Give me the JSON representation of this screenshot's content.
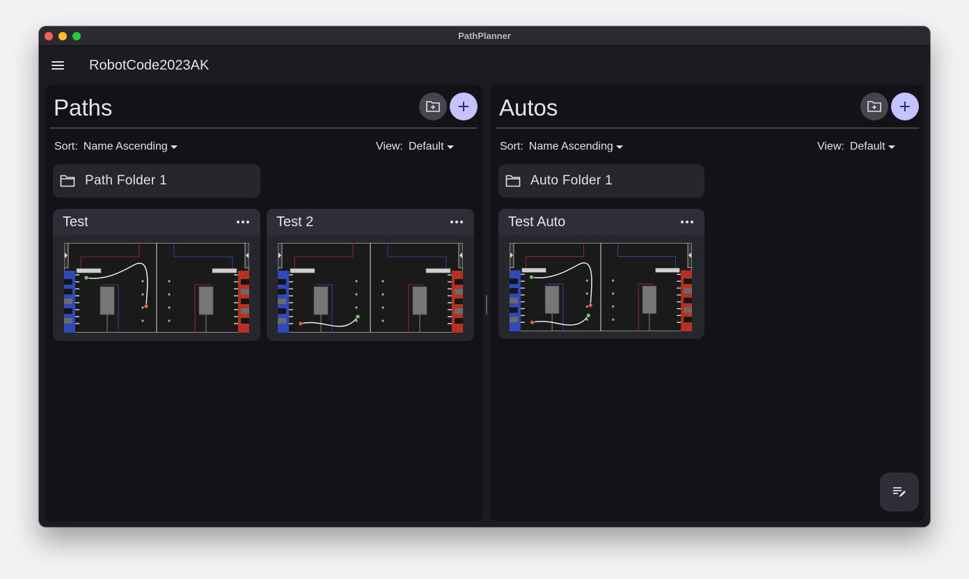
{
  "window": {
    "title": "PathPlanner"
  },
  "appbar": {
    "project_name": "RobotCode2023AK",
    "menu_icon": "menu-icon"
  },
  "paths_panel": {
    "title": "Paths",
    "sort_label": "Sort:",
    "sort_value": "Name Ascending",
    "view_label": "View:",
    "view_value": "Default",
    "folders": [
      {
        "name": "Path Folder 1"
      }
    ],
    "items": [
      {
        "name": "Test"
      },
      {
        "name": "Test 2"
      }
    ]
  },
  "autos_panel": {
    "title": "Autos",
    "sort_label": "Sort:",
    "sort_value": "Name Ascending",
    "view_label": "View:",
    "view_value": "Default",
    "folders": [
      {
        "name": "Auto Folder 1"
      }
    ],
    "items": [
      {
        "name": "Test Auto"
      }
    ]
  },
  "colors": {
    "accent": "#c4c2ff",
    "surface": "#26262d",
    "panel": "#131317",
    "blue_alliance": "#3a5bc7",
    "red_alliance": "#c0392b",
    "path_start": "#6fcf5a",
    "path_end": "#e8603c"
  },
  "icons": [
    "menu-icon",
    "new-folder-icon",
    "add-icon",
    "folder-icon",
    "more-icon",
    "edit-notes-icon"
  ]
}
